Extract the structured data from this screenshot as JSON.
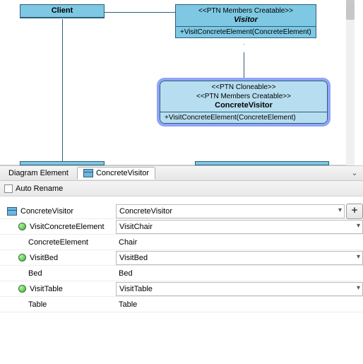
{
  "diagram": {
    "client": {
      "name": "Client"
    },
    "visitor": {
      "stereo": "<<PTN Members Creatable>>",
      "name": "Visitor",
      "op": "+VisitConcreteElement(ConcreteElement)"
    },
    "concreteVisitor": {
      "stereo1": "<<PTN Cloneable>>",
      "stereo2": "<<PTN Members Creatable>>",
      "name": "ConcreteVisitor",
      "op": "+VisitConcreteElement(ConcreteElement)"
    }
  },
  "tabs": {
    "t1": "Diagram Element",
    "t2": "ConcreteVisitor"
  },
  "options": {
    "autoRename": "Auto Rename"
  },
  "form": {
    "row0": {
      "label": "ConcreteVisitor",
      "value": "ConcreteVisitor"
    },
    "row1": {
      "label": "VisitConcreteElement",
      "value": "VisitChair"
    },
    "row2": {
      "label": "ConcreteElement",
      "value": "Chair"
    },
    "row3": {
      "label": "VisitBed",
      "value": "VisitBed"
    },
    "row4": {
      "label": "Bed",
      "value": "Bed"
    },
    "row5": {
      "label": "VisitTable",
      "value": "VisitTable"
    },
    "row6": {
      "label": "Table",
      "value": "Table"
    }
  }
}
